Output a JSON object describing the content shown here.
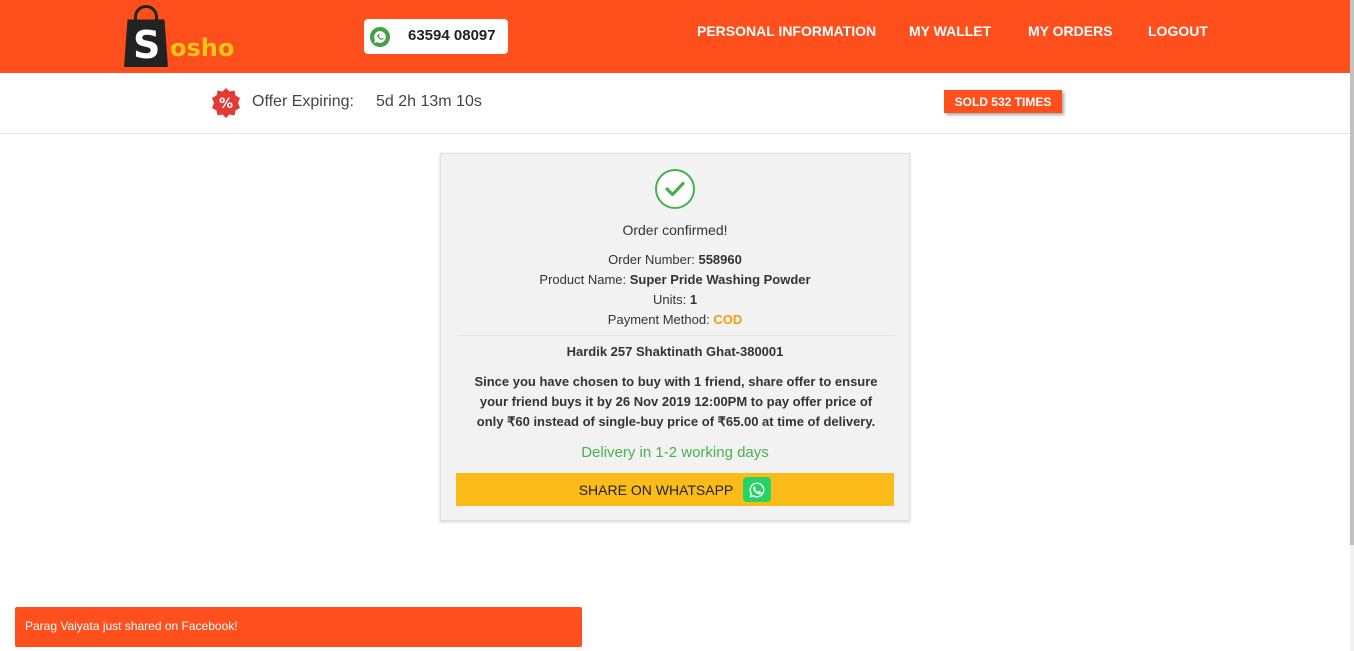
{
  "header": {
    "logo": {
      "first_letter": "S",
      "rest": "osho"
    },
    "phone": "63594 08097",
    "nav": [
      "PERSONAL INFORMATION",
      "MY WALLET",
      "MY ORDERS",
      "LOGOUT"
    ],
    "bg_color": "#ff4f1c"
  },
  "offer": {
    "badge_symbol": "%",
    "label": "Offer Expiring:",
    "time": "5d 2h 13m 10s",
    "sold": "SOLD 532 TIMES"
  },
  "order": {
    "status": "Order confirmed!",
    "number_label": "Order Number:",
    "number": "558960",
    "product_label": "Product Name:",
    "product": "Super Pride Washing Powder",
    "units_label": "Units:",
    "units": "1",
    "payment_label": "Payment Method:",
    "payment": "COD",
    "address": "Hardik 257 Shaktinath Ghat-380001",
    "share_text": "Since you have chosen to buy with 1 friend, share offer to ensure your friend buys it by 26 Nov 2019 12:00PM to pay offer price of only ₹60 instead of single-buy price of ₹65.00 at time of delivery.",
    "delivery": "Delivery in 1-2 working days",
    "share_button": "SHARE ON WHATSAPP",
    "accent_green": "#4caf50",
    "cod_color": "#f39c12"
  },
  "toast": {
    "text": "Parag Vaiyata just shared on Facebook!"
  }
}
